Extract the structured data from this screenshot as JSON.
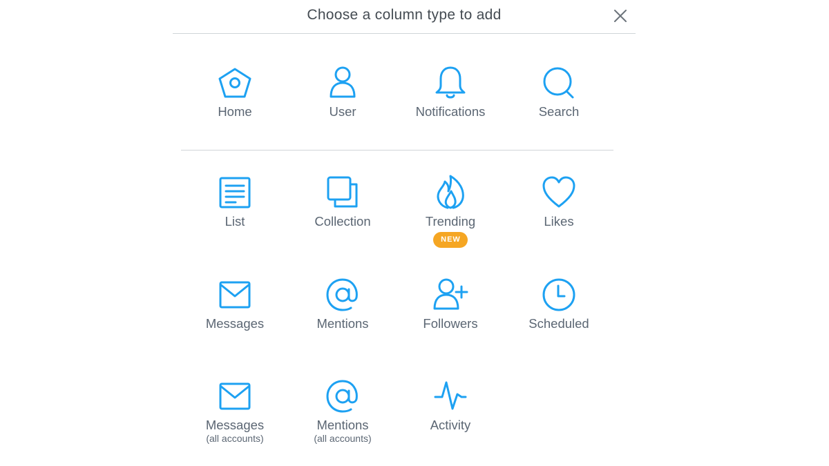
{
  "dialog": {
    "title": "Choose a column type to add",
    "close_icon": "close-icon"
  },
  "accent_color": "#1da1f2",
  "badge_color": "#f5a623",
  "items": {
    "home": {
      "label": "Home",
      "icon": "home-icon"
    },
    "user": {
      "label": "User",
      "icon": "user-icon"
    },
    "notifications": {
      "label": "Notifications",
      "icon": "bell-icon"
    },
    "search": {
      "label": "Search",
      "icon": "search-icon"
    },
    "list": {
      "label": "List",
      "icon": "list-icon"
    },
    "collection": {
      "label": "Collection",
      "icon": "collection-icon"
    },
    "trending": {
      "label": "Trending",
      "icon": "flame-icon",
      "badge": "NEW"
    },
    "likes": {
      "label": "Likes",
      "icon": "heart-icon"
    },
    "messages": {
      "label": "Messages",
      "icon": "envelope-icon"
    },
    "mentions": {
      "label": "Mentions",
      "icon": "at-icon"
    },
    "followers": {
      "label": "Followers",
      "icon": "add-user-icon"
    },
    "scheduled": {
      "label": "Scheduled",
      "icon": "clock-icon"
    },
    "messages_all": {
      "label": "Messages",
      "sublabel": "(all accounts)",
      "icon": "envelope-icon"
    },
    "mentions_all": {
      "label": "Mentions",
      "sublabel": "(all accounts)",
      "icon": "at-icon"
    },
    "activity": {
      "label": "Activity",
      "icon": "pulse-icon"
    }
  }
}
